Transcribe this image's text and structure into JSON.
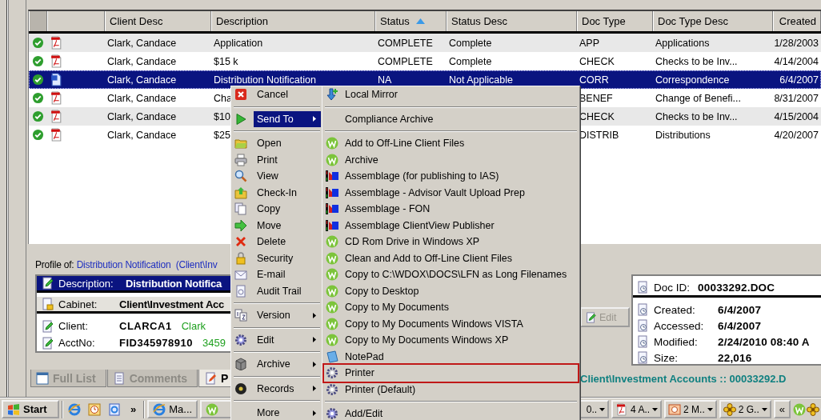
{
  "table": {
    "columns": [
      {
        "label": "Client Desc",
        "sorted": false
      },
      {
        "label": "Description",
        "sorted": false
      },
      {
        "label": "Status",
        "sorted": true
      },
      {
        "label": "Status Desc",
        "sorted": false
      },
      {
        "label": "Doc Type",
        "sorted": false
      },
      {
        "label": "Doc Type Desc",
        "sorted": false
      },
      {
        "label": "Created",
        "sorted": false
      }
    ],
    "rows": [
      {
        "selected": false,
        "kind": "pdf",
        "client": "Clark, Candace",
        "description": "Application",
        "status": "COMPLETE",
        "status_desc": "Complete",
        "doc_type": "APP",
        "doc_type_desc": "Applications",
        "created": "1/28/2003"
      },
      {
        "selected": false,
        "kind": "pdf",
        "client": "Clark, Candace",
        "description": "$15 k",
        "status": "COMPLETE",
        "status_desc": "Complete",
        "doc_type": "CHECK",
        "doc_type_desc": "Checks to be Inv...",
        "created": "4/14/2004"
      },
      {
        "selected": true,
        "kind": "word",
        "client": "Clark, Candace",
        "description": "Distribution Notification",
        "status": "NA",
        "status_desc": "Not Applicable",
        "doc_type": "CORR",
        "doc_type_desc": "Correspondence",
        "created": "6/4/2007"
      },
      {
        "selected": false,
        "kind": "pdf",
        "client": "Clark, Candace",
        "description": "Cha",
        "doc_type": "BENEF",
        "doc_type_desc": "Change of Benefi...",
        "created": "8/31/2007"
      },
      {
        "selected": false,
        "kind": "pdf",
        "client": "Clark, Candace",
        "description": "$10",
        "doc_type": "CHECK",
        "doc_type_desc": "Checks to be Inv...",
        "created": "4/15/2004"
      },
      {
        "selected": false,
        "kind": "pdf",
        "client": "Clark, Candace",
        "description": "$25",
        "doc_type": "DISTRIB",
        "doc_type_desc": "Distributions",
        "created": "4/20/2007"
      }
    ]
  },
  "profile": {
    "prefix": "Profile of:",
    "title": "Distribution Notification  (Client\\Inv",
    "rows": [
      {
        "kind": "title",
        "label": "Description:",
        "value": "Distribution Notifica"
      },
      {
        "kind": "group",
        "label": "Cabinet:",
        "value": "Client\\Investment Acc"
      },
      {
        "kind": "field",
        "label": "Client:",
        "value": "CLARCA1",
        "extra": "Clark"
      },
      {
        "kind": "field",
        "label": "AcctNo:",
        "value": "FID345978910",
        "extra": "3459"
      }
    ]
  },
  "edit_button": {
    "label": "Edit",
    "disabled": true
  },
  "details": {
    "rows": [
      {
        "kind": "header",
        "label": "Doc ID:",
        "value": "00033292.DOC"
      },
      {
        "kind": "field",
        "label": "Created:",
        "value": "6/4/2007"
      },
      {
        "kind": "field",
        "label": "Accessed:",
        "value": "6/4/2007"
      },
      {
        "kind": "field",
        "label": "Modified:",
        "value": "2/24/2010 08:40 A"
      },
      {
        "kind": "field",
        "label": "Size:",
        "value": "22,016"
      }
    ]
  },
  "tabs": [
    {
      "label": "Full List",
      "selected": false,
      "kind": "list"
    },
    {
      "label": "Comments",
      "selected": false,
      "kind": "comments"
    },
    {
      "label": "P",
      "selected": true,
      "kind": "profile"
    }
  ],
  "status_bar": {
    "path": "Client\\Investment Accounts :: 00033292.D"
  },
  "taskbar": {
    "start": "Start",
    "more": "»",
    "tasks": [
      {
        "label": "Ma...",
        "kind": "ie"
      },
      {
        "kind": "w"
      }
    ],
    "groups": [
      {
        "label": "0..",
        "kind": "none"
      },
      {
        "label": "4 A..",
        "kind": "pdf"
      },
      {
        "label": "2 M..",
        "kind": "ppt"
      },
      {
        "label": "2 G..",
        "kind": "flower"
      }
    ],
    "collapse": "«"
  },
  "context_menu": {
    "sections": [
      [
        {
          "label": "Cancel",
          "kind": "cancel",
          "selected": false,
          "submenu": false
        }
      ],
      [
        {
          "label": "Send To",
          "kind": "play",
          "selected": true,
          "submenu": true
        }
      ],
      [
        {
          "label": "Open",
          "kind": "open",
          "selected": false,
          "submenu": false
        },
        {
          "label": "Print",
          "kind": "print",
          "selected": false,
          "submenu": false
        },
        {
          "label": "View",
          "kind": "view",
          "selected": false,
          "submenu": false
        },
        {
          "label": "Check-In",
          "kind": "checkin",
          "selected": false,
          "submenu": false
        },
        {
          "label": "Copy",
          "kind": "copy",
          "selected": false,
          "submenu": false
        },
        {
          "label": "Move",
          "kind": "move",
          "selected": false,
          "submenu": false
        },
        {
          "label": "Delete",
          "kind": "delete",
          "selected": false,
          "submenu": false
        },
        {
          "label": "Security",
          "kind": "security",
          "selected": false,
          "submenu": false
        },
        {
          "label": "E-mail",
          "kind": "email",
          "selected": false,
          "submenu": false
        },
        {
          "label": "Audit Trail",
          "kind": "audit",
          "selected": false,
          "submenu": false
        }
      ],
      [
        {
          "label": "Version",
          "kind": "version",
          "selected": false,
          "submenu": true
        }
      ],
      [
        {
          "label": "Edit",
          "kind": "gear",
          "selected": false,
          "submenu": true
        }
      ],
      [
        {
          "label": "Archive",
          "kind": "archive",
          "selected": false,
          "submenu": true
        }
      ],
      [
        {
          "label": "Records",
          "kind": "records",
          "selected": false,
          "submenu": true
        }
      ],
      [
        {
          "label": "More",
          "kind": "none",
          "selected": false,
          "submenu": true
        }
      ]
    ]
  },
  "send_to_menu": {
    "sections": [
      [
        {
          "label": "Local Mirror",
          "kind": "mirror",
          "marked": false
        }
      ],
      [
        {
          "label": "Compliance Archive",
          "kind": "none",
          "marked": false
        }
      ],
      [
        {
          "label": "Add to Off-Line Client Files",
          "kind": "w",
          "marked": false
        },
        {
          "label": "Archive",
          "kind": "w",
          "marked": false
        },
        {
          "label": "Assemblage (for publishing to IAS)",
          "kind": "assemblage",
          "marked": false
        },
        {
          "label": "Assemblage - Advisor Vault Upload Prep",
          "kind": "assemblage",
          "marked": false
        },
        {
          "label": "Assemblage - FON",
          "kind": "assemblage",
          "marked": false
        },
        {
          "label": "Assemblage ClientView Publisher",
          "kind": "assemblage",
          "marked": false
        },
        {
          "label": "CD Rom Drive in Windows XP",
          "kind": "w",
          "marked": false
        },
        {
          "label": "Clean and Add to Off-Line Client Files",
          "kind": "w",
          "marked": false
        },
        {
          "label": "Copy to C:\\WDOX\\DOCS\\LFN as Long Filenames",
          "kind": "w",
          "marked": false
        },
        {
          "label": "Copy to Desktop",
          "kind": "w",
          "marked": false
        },
        {
          "label": "Copy to My Documents",
          "kind": "w",
          "marked": false
        },
        {
          "label": "Copy to My Documents Windows VISTA",
          "kind": "w",
          "marked": false
        },
        {
          "label": "Copy to My Documents Windows XP",
          "kind": "w",
          "marked": false
        },
        {
          "label": "NotePad",
          "kind": "notepad",
          "marked": false
        },
        {
          "label": "Printer",
          "kind": "printer",
          "marked": true
        },
        {
          "label": "Printer (Default)",
          "kind": "printer",
          "marked": false
        }
      ],
      [
        {
          "label": "Add/Edit",
          "kind": "gear",
          "marked": false
        }
      ]
    ]
  }
}
